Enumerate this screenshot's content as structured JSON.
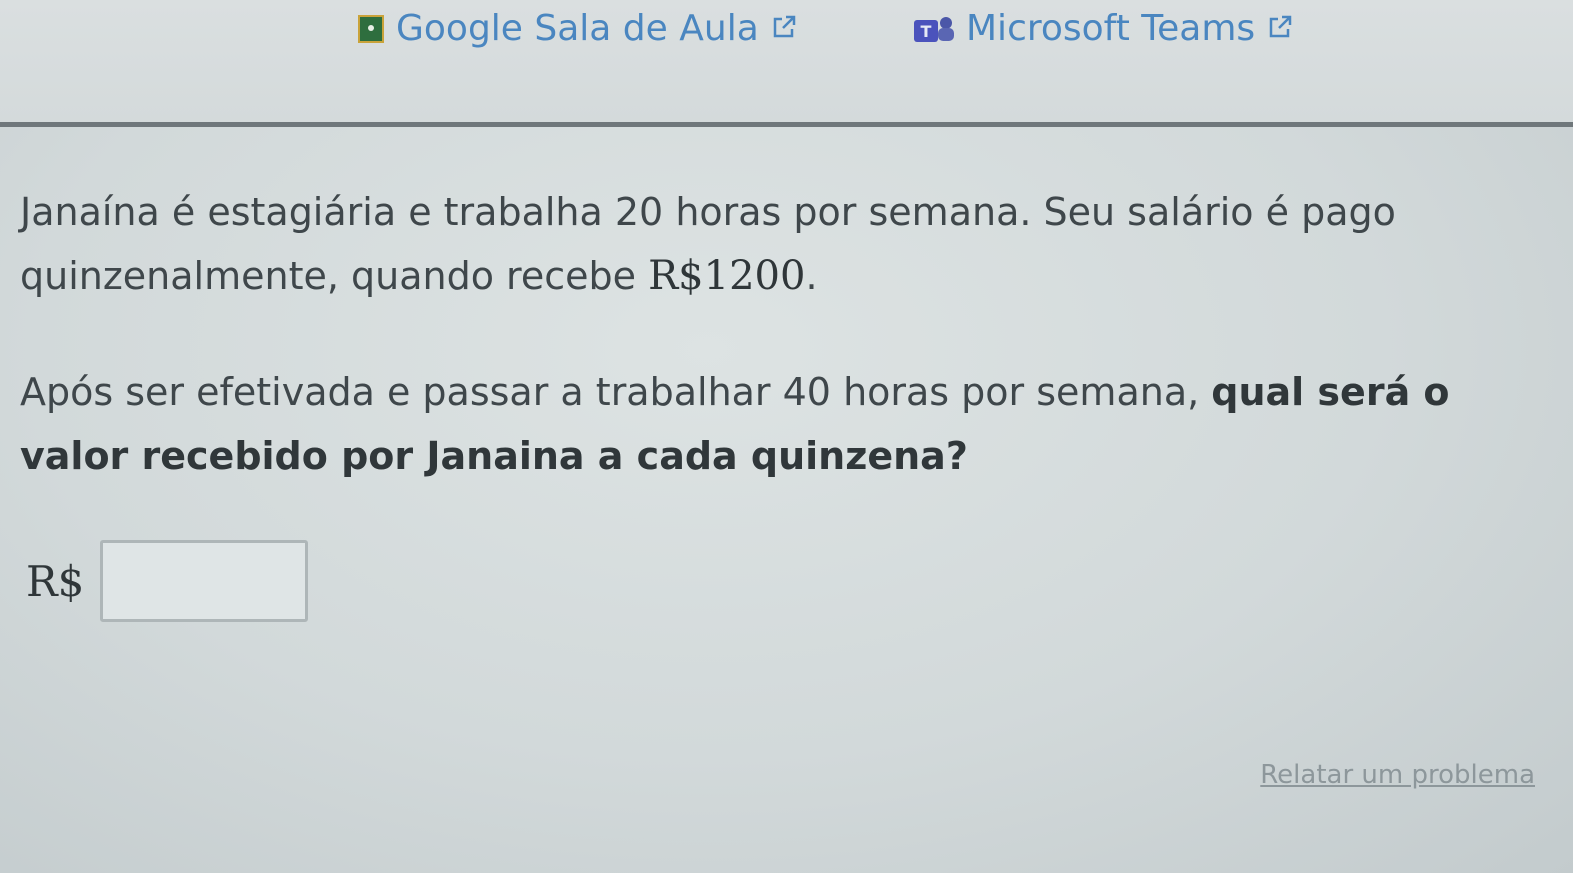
{
  "header": {
    "classroom_label": "Google Sala de Aula",
    "teams_label": "Microsoft Teams"
  },
  "question": {
    "paragraph1_text": "Janaína é estagiária e trabalha 20 horas por semana. Seu salário é pago quinzenalmente, quando recebe ",
    "paragraph1_amount": "R$1200",
    "paragraph1_end": ".",
    "paragraph2_text": "Após ser efetivada e passar a trabalhar 40 horas por semana, ",
    "paragraph2_bold": "qual será o valor recebido por Janaina a cada quinzena?"
  },
  "answer": {
    "currency_label": "R$",
    "value": ""
  },
  "footer": {
    "report_label": "Relatar um problema"
  },
  "colors": {
    "link": "#4a86c0",
    "text": "#3f474b",
    "background": "#d6dcdd",
    "divider": "#6f777b"
  },
  "icons": [
    "google-classroom-icon",
    "microsoft-teams-icon",
    "external-link-icon"
  ]
}
